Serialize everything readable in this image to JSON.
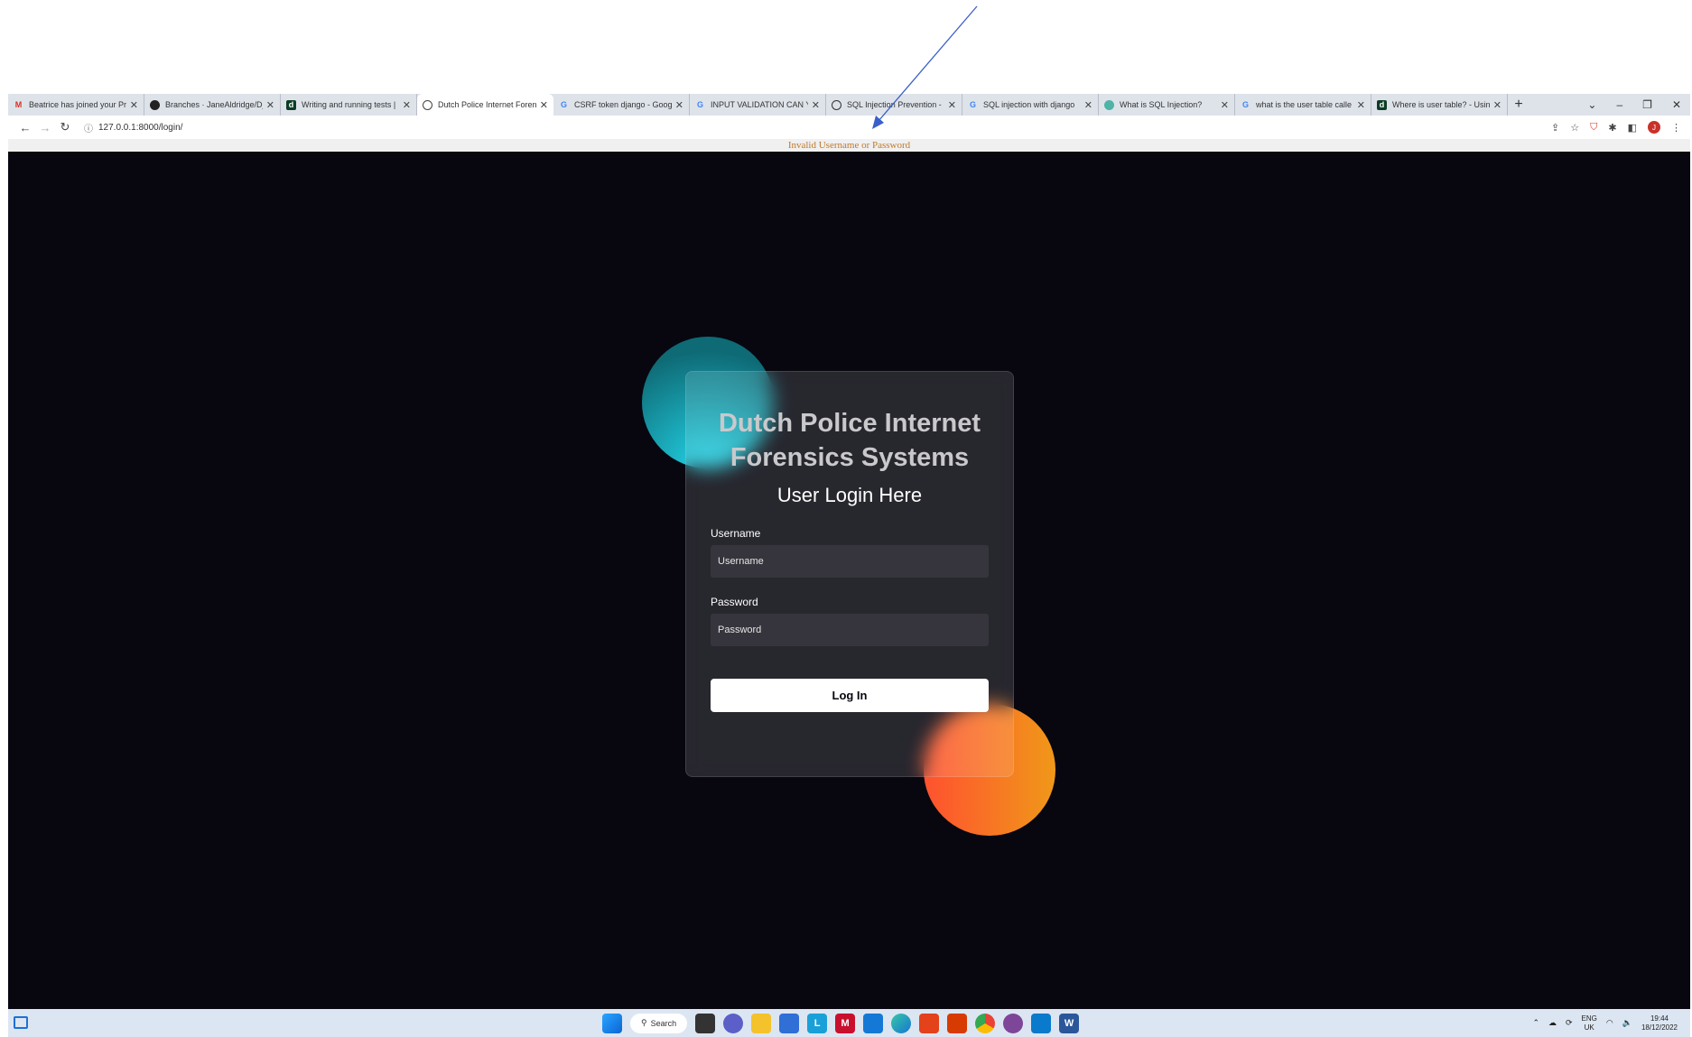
{
  "browser": {
    "tabs": [
      {
        "title": "Beatrice has joined your Pr",
        "icon": "gmail-icon",
        "active": false
      },
      {
        "title": "Branches · JaneAldridge/Dj",
        "icon": "github-icon",
        "active": false
      },
      {
        "title": "Writing and running tests |",
        "icon": "django-icon",
        "active": false
      },
      {
        "title": "Dutch Police Internet Foren",
        "icon": "globe-icon",
        "active": true
      },
      {
        "title": "CSRF token django - Goog",
        "icon": "google-icon",
        "active": false
      },
      {
        "title": "INPUT VALIDATION CAN Y",
        "icon": "google-icon",
        "active": false
      },
      {
        "title": "SQL Injection Prevention -",
        "icon": "owasp-icon",
        "active": false
      },
      {
        "title": "SQL injection with django",
        "icon": "google-icon",
        "active": false
      },
      {
        "title": "What is SQL Injection?",
        "icon": "site-icon",
        "active": false
      },
      {
        "title": "what is the user table calle",
        "icon": "google-icon",
        "active": false
      },
      {
        "title": "Where is user table? - Usin",
        "icon": "django-icon",
        "active": false
      }
    ],
    "new_tab": "+",
    "url": "127.0.0.1:8000/login/"
  },
  "message": "Invalid Username or Password",
  "login": {
    "title": "Dutch Police Internet Forensics Systems",
    "subtitle": "User Login Here",
    "username_label": "Username",
    "username_placeholder": "Username",
    "password_label": "Password",
    "password_placeholder": "Password",
    "button_label": "Log In"
  },
  "colors": {
    "page_background": "#080710",
    "message_text": "#c0782a",
    "teal_shape": "#23d5e8",
    "orange_shape_start": "#ff512f",
    "orange_shape_end": "#f09819"
  },
  "taskbar": {
    "search_label": "Search",
    "language": "ENG",
    "region": "UK",
    "time": "19:44",
    "date": "18/12/2022"
  }
}
